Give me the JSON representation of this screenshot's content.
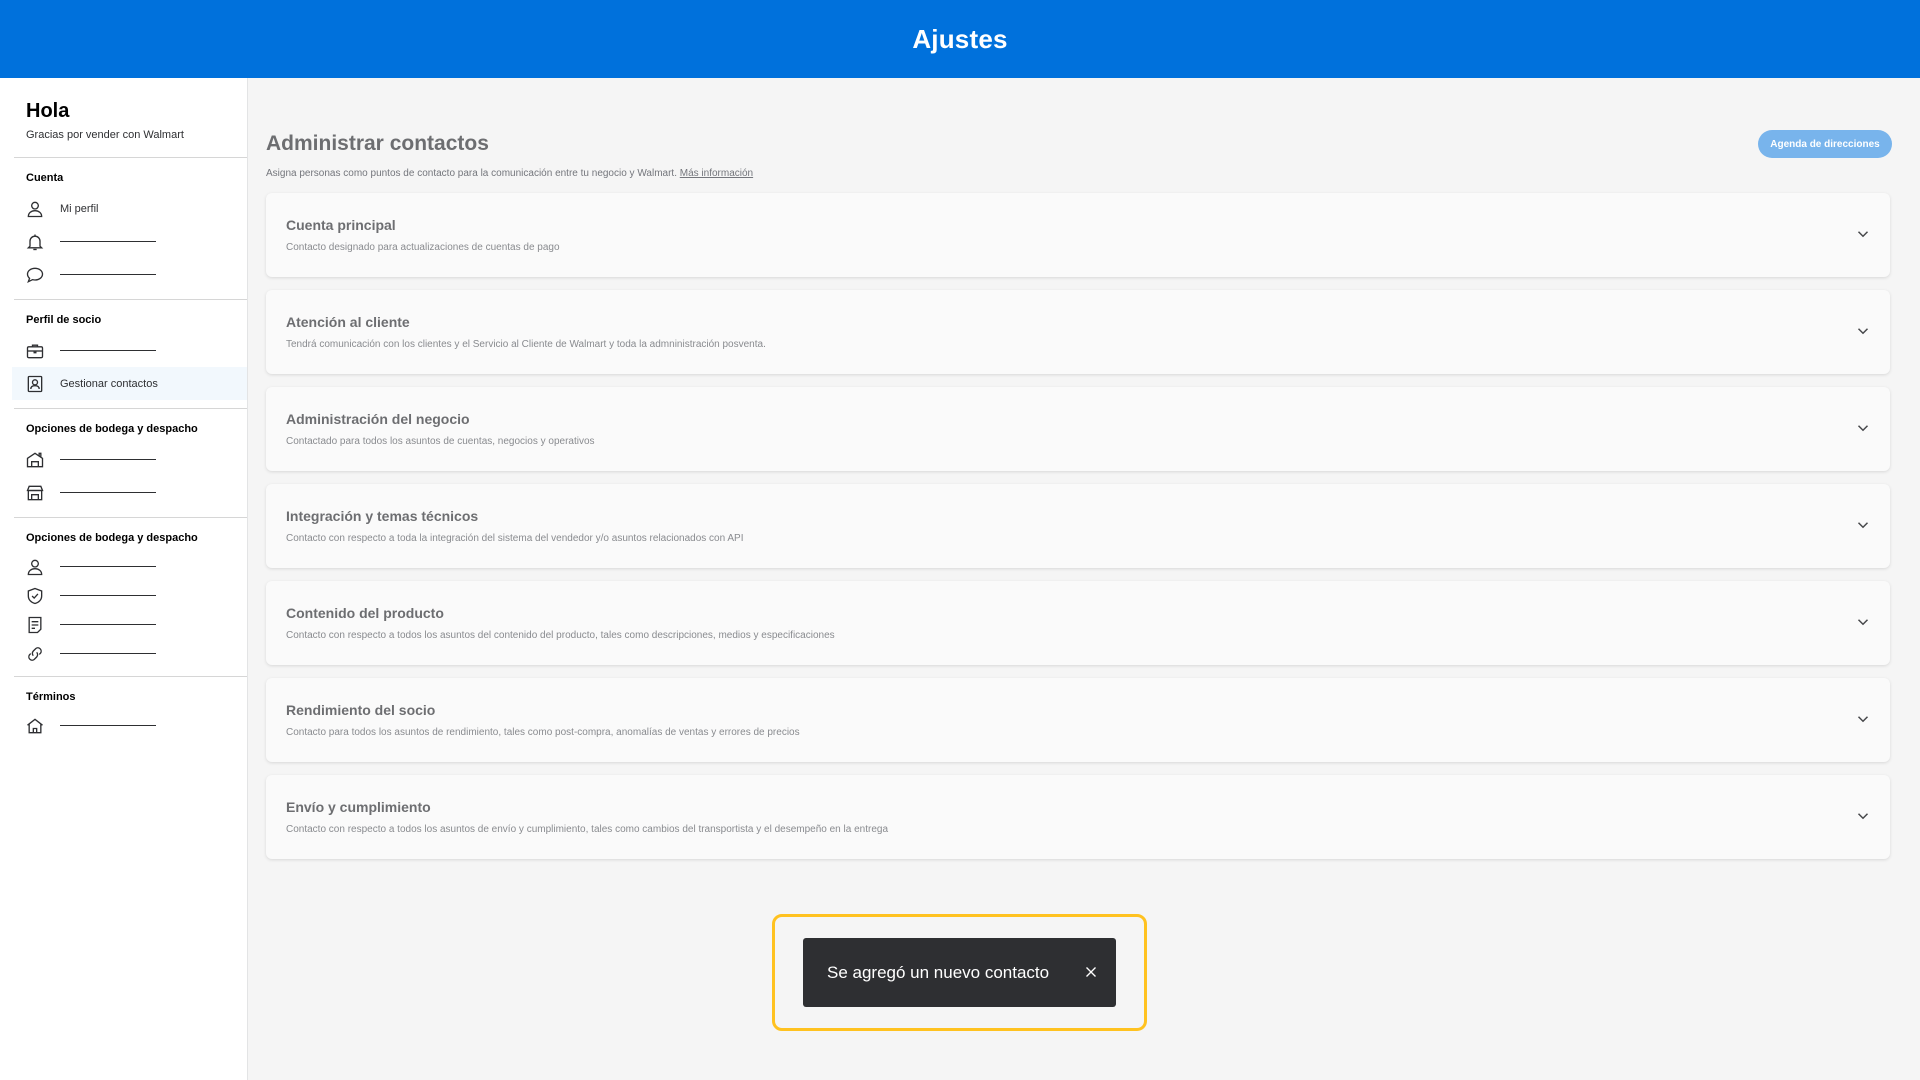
{
  "header": {
    "title": "Ajustes"
  },
  "sidebar": {
    "greeting": "Hola",
    "subtitle": "Gracias por vender con Walmart",
    "sections": [
      {
        "title": "Cuenta",
        "items": [
          {
            "icon": "user-icon",
            "label": "Mi perfil"
          },
          {
            "icon": "bell-icon",
            "label": ""
          },
          {
            "icon": "chat-icon",
            "label": ""
          }
        ]
      },
      {
        "title": "Perfil de socio",
        "items": [
          {
            "icon": "briefcase-icon",
            "label": ""
          },
          {
            "icon": "contact-card-icon",
            "label": "Gestionar contactos",
            "active": true
          }
        ]
      },
      {
        "title": "Opciones de bodega y despacho",
        "items": [
          {
            "icon": "warehouse-icon",
            "label": ""
          },
          {
            "icon": "store-icon",
            "label": ""
          }
        ]
      },
      {
        "title": "Opciones de bodega y despacho",
        "items": [
          {
            "icon": "user-icon",
            "label": ""
          },
          {
            "icon": "shield-check-icon",
            "label": ""
          },
          {
            "icon": "document-icon",
            "label": ""
          },
          {
            "icon": "link-icon",
            "label": ""
          }
        ]
      },
      {
        "title": "Términos",
        "items": [
          {
            "icon": "home-icon",
            "label": ""
          }
        ]
      }
    ]
  },
  "main": {
    "title": "Administrar contactos",
    "address_book_button": "Agenda de direcciones",
    "description": "Asigna personas como puntos de contacto para la comunicación entre tu negocio y Walmart.",
    "more_info_link": "Más información",
    "cards": [
      {
        "title": "Cuenta principal",
        "desc": "Contacto designado para actualizaciones de cuentas de pago"
      },
      {
        "title": "Atención al cliente",
        "desc": "Tendrá comunicación con los clientes y el Servicio al Cliente de Walmart y toda la admninistración posventa."
      },
      {
        "title": "Administración del negocio",
        "desc": "Contactado para todos los asuntos de cuentas, negocios y operativos"
      },
      {
        "title": "Integración y temas técnicos",
        "desc": "Contacto con respecto a toda la integración del sistema del vendedor y/o asuntos relacionados con API"
      },
      {
        "title": "Contenido del producto",
        "desc": "Contacto con respecto a todos los asuntos del contenido del producto, tales como descripciones, medios y especificaciones"
      },
      {
        "title": "Rendimiento del socio",
        "desc": "Contacto para todos los asuntos de rendimiento, tales como post-compra, anomalías de ventas y errores de precios"
      },
      {
        "title": "Envío y cumplimiento",
        "desc": "Contacto con respecto a todos los asuntos de envío y cumplimiento, tales como cambios del transportista y el desempeño en la entrega"
      }
    ]
  },
  "toast": {
    "message": "Se agregó un nuevo contacto"
  },
  "colors": {
    "brand": "#0071dc",
    "highlight": "#ffc220",
    "toast_bg": "#2e2f32"
  }
}
